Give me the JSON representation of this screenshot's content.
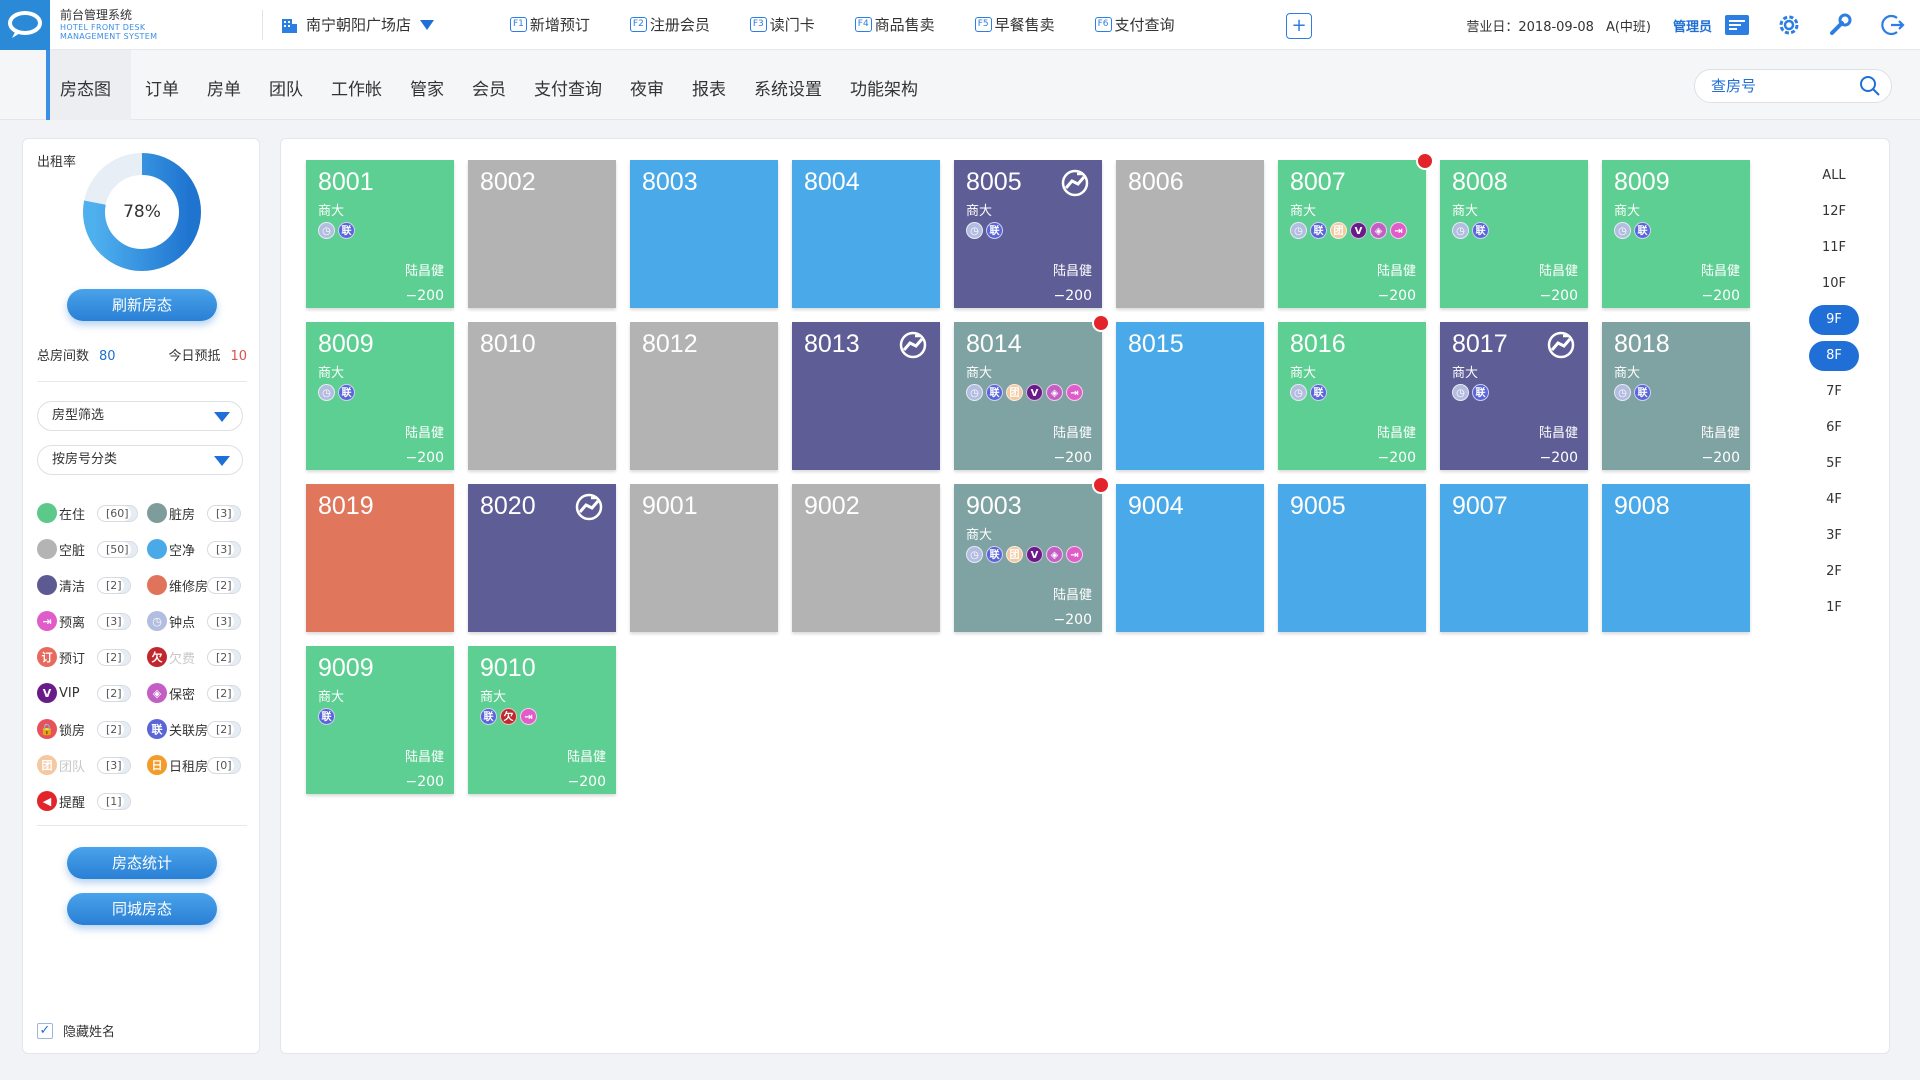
{
  "app": {
    "name_cn": "前台管理系统",
    "name_en_1": "HOTEL FRONT DESK",
    "name_en_2": "MANAGEMENT SYSTEM",
    "store": "南宁朝阳广场店"
  },
  "fkeys": [
    {
      "key": "F1",
      "label": "新增预订"
    },
    {
      "key": "F2",
      "label": "注册会员"
    },
    {
      "key": "F3",
      "label": "读门卡"
    },
    {
      "key": "F4",
      "label": "商品售卖"
    },
    {
      "key": "F5",
      "label": "早餐售卖"
    },
    {
      "key": "F6",
      "label": "支付查询"
    }
  ],
  "plus": "+",
  "topright": {
    "business_day": "营业日：2018-09-08",
    "shift": "A(中班)",
    "user": "管理员"
  },
  "nav": [
    "房态图",
    "订单",
    "房单",
    "团队",
    "工作帐",
    "管家",
    "会员",
    "支付查询",
    "夜审",
    "报表",
    "系统设置",
    "功能架构"
  ],
  "search": {
    "placeholder": "查房号"
  },
  "left": {
    "occupancy_label": "出租率",
    "occupancy_value": "78%",
    "occupancy_fraction": 0.78,
    "refresh_btn": "刷新房态",
    "total_rooms_label": "总房间数",
    "total_rooms": "80",
    "today_booking_label": "今日预抵",
    "today_booking": "10",
    "filter_type": "房型筛选",
    "filter_number": "按房号分类",
    "stats_btn": "房态统计",
    "city_btn": "同城房态",
    "hide_name": "隐藏姓名",
    "legend": [
      [
        {
          "name": "在住",
          "count": "[60]",
          "color": "#5bc98a",
          "glyph": "",
          "faded": false
        },
        {
          "name": "脏房",
          "count": "[3]",
          "color": "#7e9c9c",
          "glyph": "",
          "faded": false
        }
      ],
      [
        {
          "name": "空脏",
          "count": "[50]",
          "color": "#b4b4b4",
          "glyph": "",
          "faded": false
        },
        {
          "name": "空净",
          "count": "[3]",
          "color": "#4aaae8",
          "glyph": "",
          "faded": false
        }
      ],
      [
        {
          "name": "清洁",
          "count": "[2]",
          "color": "#5d5a92",
          "glyph": "",
          "faded": false
        },
        {
          "name": "维修房",
          "count": "[2]",
          "color": "#e0745a",
          "glyph": "",
          "faded": false
        }
      ],
      [
        {
          "name": "预离",
          "count": "[3]",
          "color": "#e05cc8",
          "glyph": "⇥",
          "faded": false
        },
        {
          "name": "钟点",
          "count": "[3]",
          "color": "#b3bde0",
          "glyph": "◷",
          "faded": false
        }
      ],
      [
        {
          "name": "预订",
          "count": "[2]",
          "color": "#e86a5e",
          "glyph": "订",
          "faded": false
        },
        {
          "name": "欠费",
          "count": "[2]",
          "color": "#c0282e",
          "glyph": "欠",
          "faded": true
        }
      ],
      [
        {
          "name": "VIP",
          "count": "[2]",
          "color": "#6a1b8a",
          "glyph": "V",
          "faded": false
        },
        {
          "name": "保密",
          "count": "[2]",
          "color": "#c25ec4",
          "glyph": "◈",
          "faded": false
        }
      ],
      [
        {
          "name": "锁房",
          "count": "[2]",
          "color": "#e8505b",
          "glyph": "🔒",
          "faded": false
        },
        {
          "name": "关联房",
          "count": "[2]",
          "color": "#5a66d8",
          "glyph": "联",
          "faded": false
        }
      ],
      [
        {
          "name": "团队",
          "count": "[3]",
          "color": "#f4c8a0",
          "glyph": "团",
          "faded": true
        },
        {
          "name": "日租房",
          "count": "[0]",
          "color": "#f39c2a",
          "glyph": "日",
          "faded": false
        }
      ],
      [
        {
          "name": "提醒",
          "count": "[1]",
          "color": "#e3242b",
          "glyph": "◀",
          "faded": false
        }
      ]
    ]
  },
  "colors": {
    "occupied": "#5ecf92",
    "vacant_dirty": "#b3b3b3",
    "vacant_clean": "#4aa9e8",
    "cleaning": "#5f5d96",
    "dirty": "#7fa2a2",
    "maintenance": "#e0775d",
    "accent": "#1f6fd6"
  },
  "rooms": [
    {
      "no": "8001",
      "state": "occupied",
      "sub": "商大",
      "icons": [
        "hour",
        "link"
      ],
      "guest": "陆昌健",
      "amount": "−200",
      "alert": false,
      "dirty_icon": false
    },
    {
      "no": "8002",
      "state": "vacant_dirty",
      "sub": "",
      "icons": [],
      "guest": "",
      "amount": "",
      "alert": false,
      "dirty_icon": false
    },
    {
      "no": "8003",
      "state": "vacant_clean",
      "sub": "",
      "icons": [],
      "guest": "",
      "amount": "",
      "alert": false,
      "dirty_icon": false
    },
    {
      "no": "8004",
      "state": "vacant_clean",
      "sub": "",
      "icons": [],
      "guest": "",
      "amount": "",
      "alert": false,
      "dirty_icon": false
    },
    {
      "no": "8005",
      "state": "cleaning",
      "sub": "商大",
      "icons": [
        "hour",
        "link"
      ],
      "guest": "陆昌健",
      "amount": "−200",
      "alert": false,
      "dirty_icon": true
    },
    {
      "no": "8006",
      "state": "vacant_dirty",
      "sub": "",
      "icons": [],
      "guest": "",
      "amount": "",
      "alert": false,
      "dirty_icon": false
    },
    {
      "no": "8007",
      "state": "occupied",
      "sub": "商大",
      "icons": [
        "hour",
        "link",
        "team",
        "vip",
        "secret",
        "leave"
      ],
      "guest": "陆昌健",
      "amount": "−200",
      "alert": true,
      "dirty_icon": false
    },
    {
      "no": "8008",
      "state": "occupied",
      "sub": "商大",
      "icons": [
        "hour",
        "link"
      ],
      "guest": "陆昌健",
      "amount": "−200",
      "alert": false,
      "dirty_icon": false
    },
    {
      "no": "8009",
      "state": "occupied",
      "sub": "商大",
      "icons": [
        "hour",
        "link"
      ],
      "guest": "陆昌健",
      "amount": "−200",
      "alert": false,
      "dirty_icon": false
    },
    {
      "no": "8009",
      "state": "occupied",
      "sub": "商大",
      "icons": [
        "hour",
        "link"
      ],
      "guest": "陆昌健",
      "amount": "−200",
      "alert": false,
      "dirty_icon": false
    },
    {
      "no": "8010",
      "state": "vacant_dirty",
      "sub": "",
      "icons": [],
      "guest": "",
      "amount": "",
      "alert": false,
      "dirty_icon": false
    },
    {
      "no": "8012",
      "state": "vacant_dirty",
      "sub": "",
      "icons": [],
      "guest": "",
      "amount": "",
      "alert": false,
      "dirty_icon": false
    },
    {
      "no": "8013",
      "state": "cleaning",
      "sub": "",
      "icons": [],
      "guest": "",
      "amount": "",
      "alert": false,
      "dirty_icon": true
    },
    {
      "no": "8014",
      "state": "dirty",
      "sub": "商大",
      "icons": [
        "hour",
        "link",
        "team",
        "vip",
        "secret",
        "leave"
      ],
      "guest": "陆昌健",
      "amount": "−200",
      "alert": true,
      "dirty_icon": false
    },
    {
      "no": "8015",
      "state": "vacant_clean",
      "sub": "",
      "icons": [],
      "guest": "",
      "amount": "",
      "alert": false,
      "dirty_icon": false
    },
    {
      "no": "8016",
      "state": "occupied",
      "sub": "商大",
      "icons": [
        "hour",
        "link"
      ],
      "guest": "陆昌健",
      "amount": "−200",
      "alert": false,
      "dirty_icon": false
    },
    {
      "no": "8017",
      "state": "cleaning",
      "sub": "商大",
      "icons": [
        "hour",
        "link"
      ],
      "guest": "陆昌健",
      "amount": "−200",
      "alert": false,
      "dirty_icon": true
    },
    {
      "no": "8018",
      "state": "dirty",
      "sub": "商大",
      "icons": [
        "hour",
        "link"
      ],
      "guest": "陆昌健",
      "amount": "−200",
      "alert": false,
      "dirty_icon": false
    },
    {
      "no": "8019",
      "state": "maintenance",
      "sub": "",
      "icons": [],
      "guest": "",
      "amount": "",
      "alert": false,
      "dirty_icon": false
    },
    {
      "no": "8020",
      "state": "cleaning",
      "sub": "",
      "icons": [],
      "guest": "",
      "amount": "",
      "alert": false,
      "dirty_icon": true
    },
    {
      "no": "9001",
      "state": "vacant_dirty",
      "sub": "",
      "icons": [],
      "guest": "",
      "amount": "",
      "alert": false,
      "dirty_icon": false
    },
    {
      "no": "9002",
      "state": "vacant_dirty",
      "sub": "",
      "icons": [],
      "guest": "",
      "amount": "",
      "alert": false,
      "dirty_icon": false
    },
    {
      "no": "9003",
      "state": "dirty",
      "sub": "商大",
      "icons": [
        "hour",
        "link",
        "team",
        "vip",
        "secret",
        "leave"
      ],
      "guest": "陆昌健",
      "amount": "−200",
      "alert": true,
      "dirty_icon": false
    },
    {
      "no": "9004",
      "state": "vacant_clean",
      "sub": "",
      "icons": [],
      "guest": "",
      "amount": "",
      "alert": false,
      "dirty_icon": false
    },
    {
      "no": "9005",
      "state": "vacant_clean",
      "sub": "",
      "icons": [],
      "guest": "",
      "amount": "",
      "alert": false,
      "dirty_icon": false
    },
    {
      "no": "9007",
      "state": "vacant_clean",
      "sub": "",
      "icons": [],
      "guest": "",
      "amount": "",
      "alert": false,
      "dirty_icon": false
    },
    {
      "no": "9008",
      "state": "vacant_clean",
      "sub": "",
      "icons": [],
      "guest": "",
      "amount": "",
      "alert": false,
      "dirty_icon": false
    },
    {
      "no": "9009",
      "state": "occupied",
      "sub": "商大",
      "icons": [
        "link"
      ],
      "guest": "陆昌健",
      "amount": "−200",
      "alert": false,
      "dirty_icon": false
    },
    {
      "no": "9010",
      "state": "occupied",
      "sub": "商大",
      "icons": [
        "link",
        "owe",
        "leave"
      ],
      "guest": "陆昌健",
      "amount": "−200",
      "alert": false,
      "dirty_icon": false
    }
  ],
  "icon_glyphs": {
    "hour": {
      "glyph": "◷",
      "color": "#b3bde0"
    },
    "link": {
      "glyph": "联",
      "color": "#5a66d8"
    },
    "team": {
      "glyph": "团",
      "color": "#f4c8a0"
    },
    "vip": {
      "glyph": "V",
      "color": "#6a1b8a"
    },
    "secret": {
      "glyph": "◈",
      "color": "#c25ec4"
    },
    "leave": {
      "glyph": "⇥",
      "color": "#e05cc8"
    },
    "owe": {
      "glyph": "欠",
      "color": "#c0282e"
    }
  },
  "floors": {
    "items": [
      "ALL",
      "12F",
      "11F",
      "10F",
      "9F",
      "8F",
      "7F",
      "6F",
      "5F",
      "4F",
      "3F",
      "2F",
      "1F"
    ],
    "active": [
      "9F",
      "8F"
    ]
  }
}
